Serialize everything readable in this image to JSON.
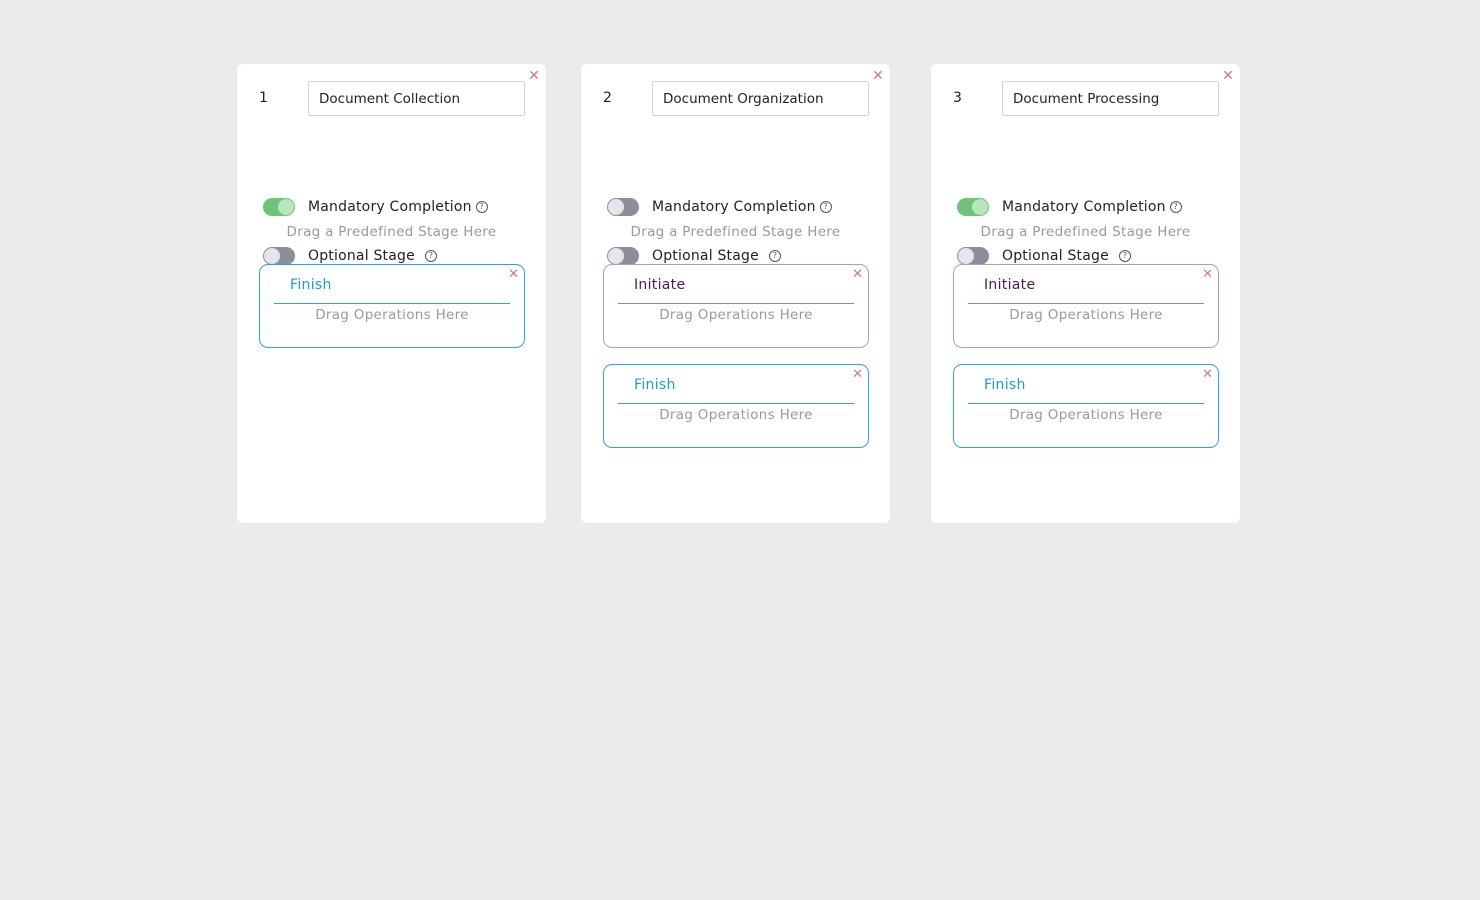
{
  "colors": {
    "background": "#ebebeb",
    "card": "#ffffff",
    "toggle_on": "#70c47a",
    "toggle_off": "#8b8f9a",
    "finish_accent": "#2aa7d6",
    "initiate_accent": "#b898c0",
    "close": "#d27a7a"
  },
  "cards": [
    {
      "number": "1",
      "name": "Document Collection",
      "mandatory_label": "Mandatory Completion",
      "mandatory_on": true,
      "optional_label": "Optional Stage",
      "optional_on": false,
      "drop_hint": "Drag a Predefined Stage Here",
      "sub_stages": [
        {
          "title": "Finish",
          "type": "finish",
          "hint": "Drag Operations Here"
        }
      ]
    },
    {
      "number": "2",
      "name": "Document Organization",
      "mandatory_label": "Mandatory Completion",
      "mandatory_on": false,
      "optional_label": "Optional Stage",
      "optional_on": false,
      "drop_hint": "Drag a Predefined Stage Here",
      "sub_stages": [
        {
          "title": "Initiate",
          "type": "initiate",
          "hint": "Drag Operations Here"
        },
        {
          "title": "Finish",
          "type": "finish",
          "hint": "Drag Operations Here"
        }
      ]
    },
    {
      "number": "3",
      "name": "Document Processing",
      "mandatory_label": "Mandatory Completion",
      "mandatory_on": true,
      "optional_label": "Optional Stage",
      "optional_on": false,
      "drop_hint": "Drag a Predefined Stage Here",
      "sub_stages": [
        {
          "title": "Initiate",
          "type": "initiate",
          "hint": "Drag Operations Here"
        },
        {
          "title": "Finish",
          "type": "finish",
          "hint": "Drag Operations Here"
        }
      ]
    }
  ]
}
